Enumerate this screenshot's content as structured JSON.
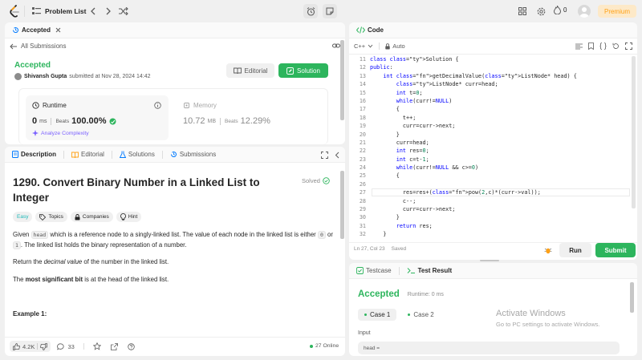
{
  "topbar": {
    "problem_list": "Problem List",
    "fire_count": "0",
    "premium": "Premium"
  },
  "submission": {
    "tab_label": "Accepted",
    "all_submissions": "All Submissions",
    "status": "Accepted",
    "user": "Shivansh Gupta",
    "submitted_at": "submitted at Nov 28, 2024 14:42",
    "editorial_btn": "Editorial",
    "solution_btn": "Solution",
    "runtime_label": "Runtime",
    "runtime_value": "0",
    "runtime_unit": "ms",
    "beats_label": "Beats",
    "runtime_beats": "100.00%",
    "analyze": "Analyze Complexity",
    "memory_label": "Memory",
    "memory_value": "10.72",
    "memory_unit": "MB",
    "memory_beats": "12.29%"
  },
  "desc": {
    "tabs": [
      "Description",
      "Editorial",
      "Solutions",
      "Submissions"
    ],
    "title": "1290. Convert Binary Number in a Linked List to Integer",
    "solved": "Solved",
    "chips": {
      "easy": "Easy",
      "topics": "Topics",
      "companies": "Companies",
      "hint": "Hint"
    },
    "p1": {
      "a": "Given ",
      "code1": "head",
      "b": " which is a reference node to a singly-linked list. The value of each node in the linked list is either ",
      "code2": "0",
      "c": " or ",
      "code3": "1",
      "d": ". The linked list holds the binary representation of a number."
    },
    "p2": {
      "a": "Return the ",
      "em": "decimal value",
      "b": " of the number in the linked list."
    },
    "p3": {
      "a": "The ",
      "strong": "most significant bit",
      "b": " is at the head of the linked list."
    },
    "example": "Example 1:",
    "footer": {
      "likes": "4.2K",
      "comments": "33",
      "online": "27 Online"
    }
  },
  "code": {
    "tab_label": "Code",
    "language": "C++",
    "auto": "Auto",
    "status": "Ln 27, Col 23",
    "saved": "Saved",
    "run": "Run",
    "submit": "Submit",
    "lines": [
      {
        "n": "11",
        "t": "class Solution {"
      },
      {
        "n": "12",
        "t": "public:"
      },
      {
        "n": "13",
        "t": "    int getDecimalValue(ListNode* head) {"
      },
      {
        "n": "14",
        "t": "        ListNode* curr=head;"
      },
      {
        "n": "15",
        "t": "        int t=0;"
      },
      {
        "n": "16",
        "t": "        while(curr!=NULL)"
      },
      {
        "n": "17",
        "t": "        {"
      },
      {
        "n": "18",
        "t": "          t++;"
      },
      {
        "n": "19",
        "t": "          curr=curr->next;"
      },
      {
        "n": "20",
        "t": "        }"
      },
      {
        "n": "21",
        "t": "        curr=head;"
      },
      {
        "n": "22",
        "t": "        int res=0;"
      },
      {
        "n": "23",
        "t": "        int c=t-1;"
      },
      {
        "n": "24",
        "t": "        while(curr!=NULL && c>=0)"
      },
      {
        "n": "25",
        "t": "        {"
      },
      {
        "n": "26",
        "t": ""
      },
      {
        "n": "27",
        "t": "          res=res+(pow(2,c)*(curr->val));"
      },
      {
        "n": "28",
        "t": "          c--;"
      },
      {
        "n": "29",
        "t": "          curr=curr->next;"
      },
      {
        "n": "30",
        "t": "        }"
      },
      {
        "n": "31",
        "t": "        return res;"
      },
      {
        "n": "32",
        "t": "    }"
      }
    ]
  },
  "result": {
    "testcase_tab": "Testcase",
    "result_tab": "Test Result",
    "status": "Accepted",
    "runtime": "Runtime: 0 ms",
    "cases": [
      "Case 1",
      "Case 2"
    ],
    "input_label": "Input",
    "input_value": "head =",
    "watermark_title": "Activate Windows",
    "watermark_sub": "Go to PC settings to activate Windows."
  },
  "colors": {
    "accent": "#2db55d",
    "premium": "#ffa116",
    "blue": "#007aff"
  }
}
